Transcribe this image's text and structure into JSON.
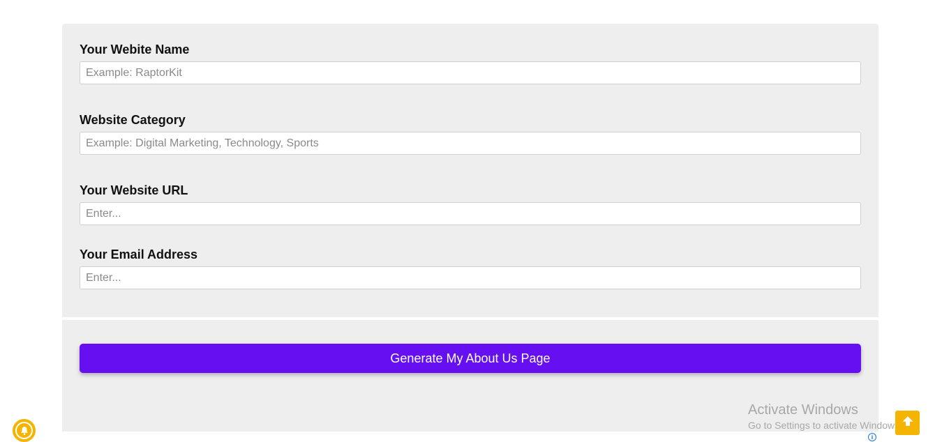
{
  "form": {
    "fields": [
      {
        "label": "Your Webite Name",
        "placeholder": "Example: RaptorKit",
        "value": ""
      },
      {
        "label": "Website Category",
        "placeholder": "Example: Digital Marketing, Technology, Sports",
        "value": ""
      },
      {
        "label": "Your Website URL",
        "placeholder": "Enter...",
        "value": ""
      },
      {
        "label": "Your Email Address",
        "placeholder": "Enter...",
        "value": ""
      }
    ],
    "submit_label": "Generate My About Us Page"
  },
  "watermark": {
    "title": "Activate Windows",
    "subtitle": "Go to Settings to activate Windows."
  },
  "icons": {
    "scroll_top": "arrow-up-icon",
    "notification": "bell-icon",
    "ad_info": "info-icon"
  },
  "colors": {
    "accent": "#6610f2",
    "panel_bg": "#eeeeee",
    "floating_button": "#f5b400"
  }
}
